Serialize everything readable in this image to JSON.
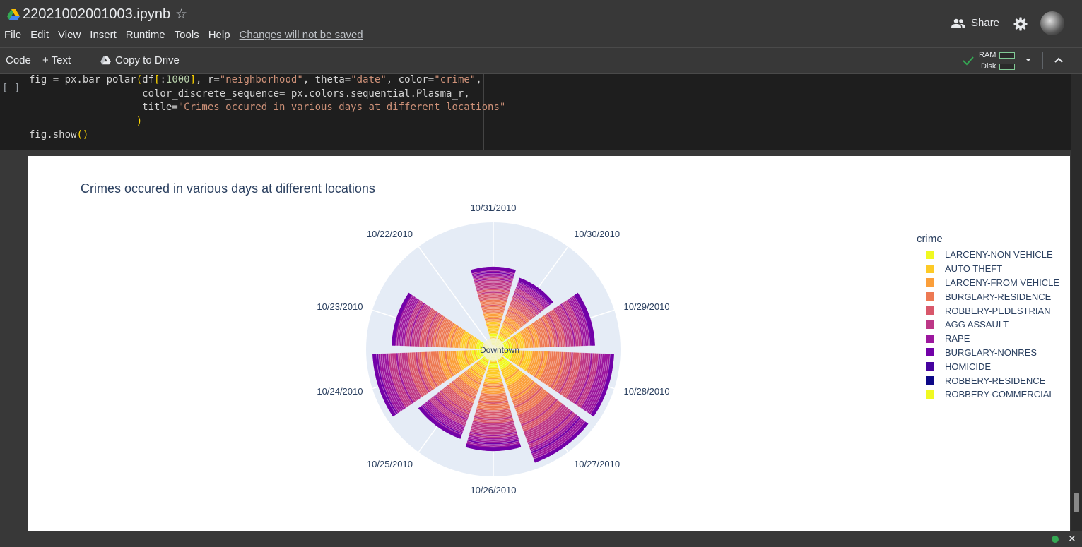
{
  "header": {
    "file_name": "22021002001003.ipynb",
    "menu": [
      "File",
      "Edit",
      "View",
      "Insert",
      "Runtime",
      "Tools",
      "Help"
    ],
    "unsaved_notice": "Changes will not be saved",
    "share_label": "Share"
  },
  "toolbar": {
    "code_label": "Code",
    "text_label": "+ Text",
    "copy_label": "Copy to Drive",
    "ram_label": "RAM",
    "disk_label": "Disk"
  },
  "cell": {
    "run_label": "[ ]",
    "code_lines": [
      "fig = px.bar_polar(df[:1000], r=\"neighborhood\", theta=\"date\", color=\"crime\",",
      "                   color_discrete_sequence= px.colors.sequential.Plasma_r,",
      "                   title=\"Crimes occured in various days at different locations\"",
      "                  )",
      "fig.show()"
    ]
  },
  "chart_data": {
    "type": "bar_polar",
    "title": "Crimes occured in various days at different locations",
    "radial_categories": [
      "Downtown"
    ],
    "angular_categories": [
      "10/31/2010",
      "10/30/2010",
      "10/29/2010",
      "10/28/2010",
      "10/27/2010",
      "10/26/2010",
      "10/25/2010",
      "10/24/2010",
      "10/23/2010",
      "10/22/2010"
    ],
    "bar_relative_radius": [
      0.65,
      0.6,
      0.8,
      0.95,
      0.95,
      0.8,
      0.75,
      0.95,
      0.8,
      0.0
    ],
    "legend_title": "crime",
    "series": [
      {
        "name": "LARCENY-NON VEHICLE",
        "color": "#f0f921"
      },
      {
        "name": "AUTO THEFT",
        "color": "#fdca26"
      },
      {
        "name": "LARCENY-FROM VEHICLE",
        "color": "#fb9f3a"
      },
      {
        "name": "BURGLARY-RESIDENCE",
        "color": "#ed7953"
      },
      {
        "name": "ROBBERY-PEDESTRIAN",
        "color": "#d8576b"
      },
      {
        "name": "AGG ASSAULT",
        "color": "#bd3786"
      },
      {
        "name": "RAPE",
        "color": "#9c179e"
      },
      {
        "name": "BURGLARY-NONRES",
        "color": "#7201a8"
      },
      {
        "name": "HOMICIDE",
        "color": "#46039f"
      },
      {
        "name": "ROBBERY-RESIDENCE",
        "color": "#0d0887"
      },
      {
        "name": "ROBBERY-COMMERCIAL",
        "color": "#f0f921"
      }
    ]
  },
  "status": {
    "close_label": "✕"
  }
}
